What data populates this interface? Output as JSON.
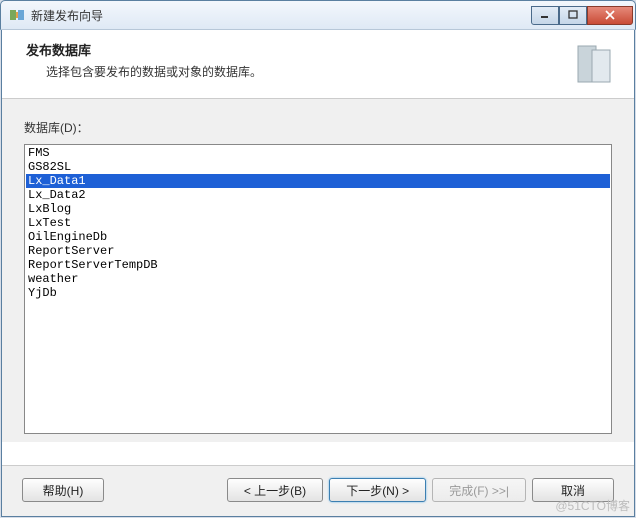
{
  "window": {
    "title": "新建发布向导"
  },
  "header": {
    "title": "发布数据库",
    "subtitle": "选择包含要发布的数据或对象的数据库。"
  },
  "content": {
    "label": "数据库(D)：",
    "items": [
      "FMS",
      "GS82SL",
      "Lx_Data1",
      "Lx_Data2",
      "LxBlog",
      "LxTest",
      "OilEngineDb",
      "ReportServer",
      "ReportServerTempDB",
      "weather",
      "YjDb"
    ],
    "selected_index": 2
  },
  "buttons": {
    "help": "帮助(H)",
    "back": "< 上一步(B)",
    "next": "下一步(N) >",
    "finish": "完成(F) >>|",
    "cancel": "取消"
  },
  "watermark": "@51CTO博客"
}
